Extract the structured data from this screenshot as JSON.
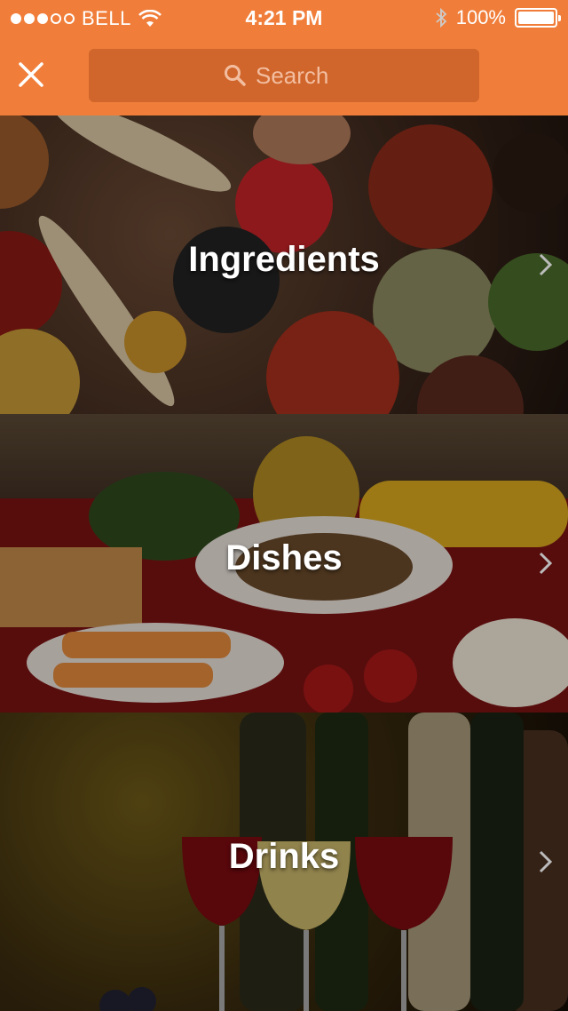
{
  "status_bar": {
    "carrier": "BELL",
    "time": "4:21 PM",
    "battery": "100%",
    "signal_filled": 3,
    "signal_total": 5
  },
  "header": {
    "close_icon": "close-icon",
    "search": {
      "placeholder": "Search",
      "icon": "search-icon"
    },
    "background_color": "#f07e3a",
    "search_background_color": "#d0662c"
  },
  "categories": [
    {
      "label": "Ingredients",
      "icon": "chevron-right-icon"
    },
    {
      "label": "Dishes",
      "icon": "chevron-right-icon"
    },
    {
      "label": "Drinks",
      "icon": "chevron-right-icon"
    }
  ]
}
